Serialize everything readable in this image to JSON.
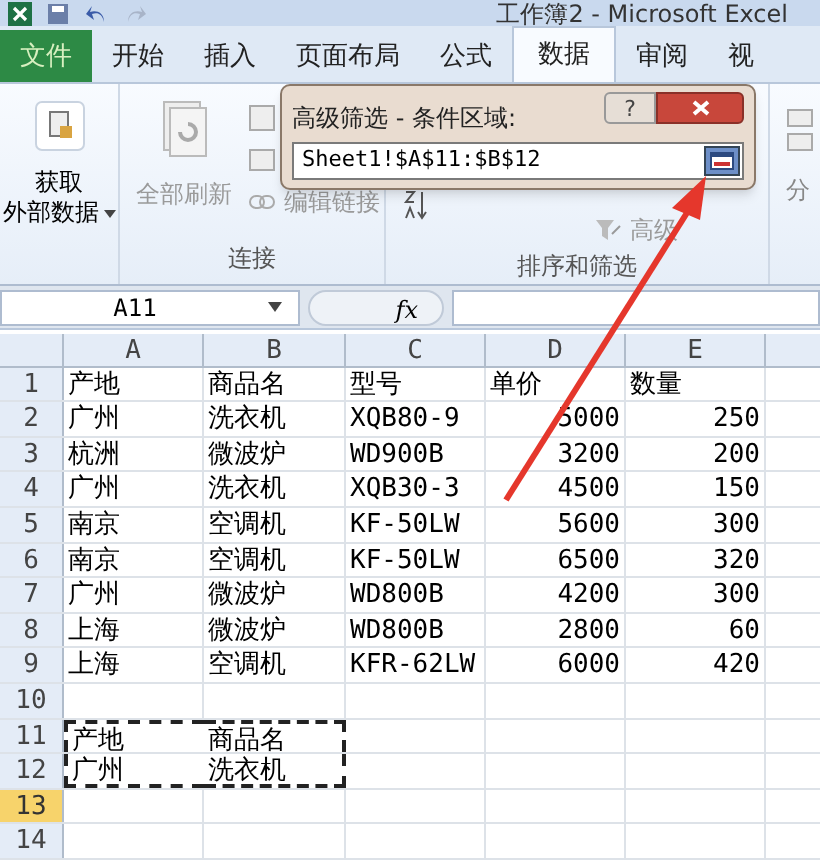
{
  "window": {
    "title": "工作簿2 - Microsoft Excel"
  },
  "tabs": [
    {
      "label": "文件",
      "kind": "file",
      "selected": false
    },
    {
      "label": "开始",
      "kind": "tab",
      "selected": false
    },
    {
      "label": "插入",
      "kind": "tab",
      "selected": false
    },
    {
      "label": "页面布局",
      "kind": "tab",
      "selected": false
    },
    {
      "label": "公式",
      "kind": "tab",
      "selected": false
    },
    {
      "label": "数据",
      "kind": "tab",
      "selected": true
    },
    {
      "label": "审阅",
      "kind": "tab",
      "selected": false
    },
    {
      "label": "视",
      "kind": "tab",
      "selected": false
    }
  ],
  "ribbon": {
    "get_data": {
      "line1": "获取",
      "line2": "外部数据"
    },
    "refresh_all": {
      "label": "全部刷新",
      "disabled": true
    },
    "edit_links": {
      "label": "编辑链接",
      "disabled": true
    },
    "connections_label": "连接",
    "advanced": {
      "label": "高级",
      "disabled": true
    },
    "sort_filter_label": "排序和筛选",
    "next_group": "分"
  },
  "dialog": {
    "title": "高级筛选 - 条件区域:",
    "help": "?",
    "value": "Sheet1!$A$11:$B$12"
  },
  "formula_bar": {
    "name_box": "A11",
    "fx": "fx"
  },
  "sheet": {
    "columns": [
      "A",
      "B",
      "C",
      "D",
      "E"
    ],
    "rows": [
      {
        "n": "1",
        "selected": false,
        "marquee": false,
        "cells": [
          "产地",
          "商品名",
          "型号",
          "单价",
          "数量"
        ]
      },
      {
        "n": "2",
        "selected": false,
        "marquee": false,
        "cells": [
          "广州",
          "洗衣机",
          "XQB80-9",
          "5000",
          "250"
        ]
      },
      {
        "n": "3",
        "selected": false,
        "marquee": false,
        "cells": [
          "杭洲",
          "微波炉",
          "WD900B",
          "3200",
          "200"
        ]
      },
      {
        "n": "4",
        "selected": false,
        "marquee": false,
        "cells": [
          "广州",
          "洗衣机",
          "XQB30-3",
          "4500",
          "150"
        ]
      },
      {
        "n": "5",
        "selected": false,
        "marquee": false,
        "cells": [
          "南京",
          "空调机",
          "KF-50LW",
          "5600",
          "300"
        ]
      },
      {
        "n": "6",
        "selected": false,
        "marquee": false,
        "cells": [
          "南京",
          "空调机",
          "KF-50LW",
          "6500",
          "320"
        ]
      },
      {
        "n": "7",
        "selected": false,
        "marquee": false,
        "cells": [
          "广州",
          "微波炉",
          "WD800B",
          "4200",
          "300"
        ]
      },
      {
        "n": "8",
        "selected": false,
        "marquee": false,
        "cells": [
          "上海",
          "微波炉",
          "WD800B",
          "2800",
          "60"
        ]
      },
      {
        "n": "9",
        "selected": false,
        "marquee": false,
        "cells": [
          "上海",
          "空调机",
          "KFR-62LW",
          "6000",
          "420"
        ]
      },
      {
        "n": "10",
        "selected": false,
        "marquee": false,
        "cells": []
      },
      {
        "n": "11",
        "selected": false,
        "marquee": true,
        "cells": [
          "产地",
          "商品名"
        ]
      },
      {
        "n": "12",
        "selected": false,
        "marquee": true,
        "cells": [
          "广州",
          "洗衣机"
        ]
      },
      {
        "n": "13",
        "selected": true,
        "marquee": false,
        "cells": []
      },
      {
        "n": "14",
        "selected": false,
        "marquee": false,
        "cells": []
      }
    ]
  }
}
